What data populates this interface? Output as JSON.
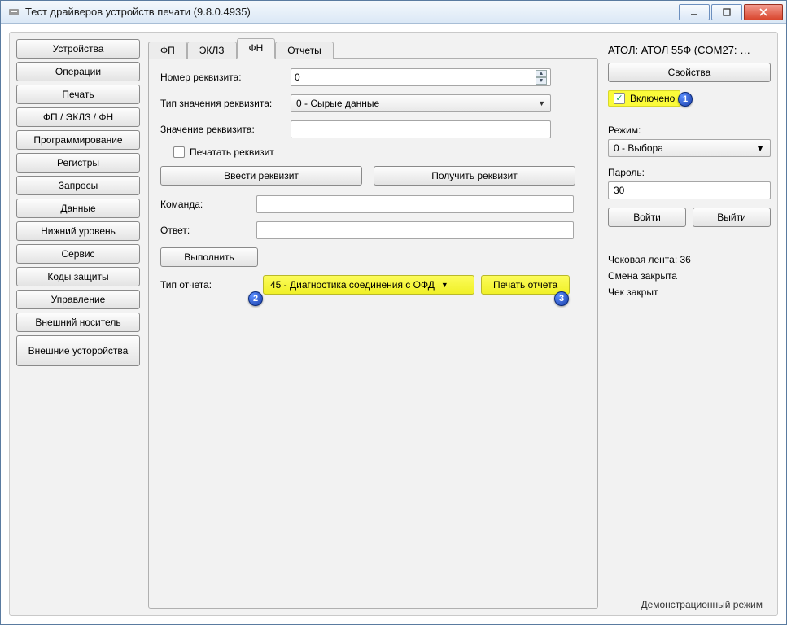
{
  "window": {
    "title": "Тест драйверов устройств печати (9.8.0.4935)"
  },
  "nav": {
    "items": [
      "Устройства",
      "Операции",
      "Печать",
      "ФП / ЭКЛЗ / ФН",
      "Программирование",
      "Регистры",
      "Запросы",
      "Данные",
      "Нижний уровень",
      "Сервис",
      "Коды защиты",
      "Управление",
      "Внешний носитель",
      "Внешние усторойства"
    ]
  },
  "tabs": {
    "items": [
      "ФП",
      "ЭКЛЗ",
      "ФН",
      "Отчеты"
    ],
    "active_index": 2
  },
  "form": {
    "requisite_number_label": "Номер реквизита:",
    "requisite_number_value": "0",
    "requisite_type_label": "Тип значения реквизита:",
    "requisite_type_value": "0 - Сырые данные",
    "requisite_value_label": "Значение реквизита:",
    "requisite_value_value": "",
    "print_req_label": "Печатать реквизит",
    "print_req_checked": false,
    "enter_req_btn": "Ввести реквизит",
    "get_req_btn": "Получить реквизит",
    "command_label": "Команда:",
    "command_value": "",
    "answer_label": "Ответ:",
    "answer_value": "",
    "execute_btn": "Выполнить",
    "report_type_label": "Тип отчета:",
    "report_type_value": "45 - Диагностика соединения с ОФД",
    "print_report_btn": "Печать отчета"
  },
  "right": {
    "device": "АТОЛ: АТОЛ 55Ф (COM27: …",
    "properties_btn": "Свойства",
    "enabled_label": "Включено",
    "enabled_checked": true,
    "mode_label": "Режим:",
    "mode_value": "0 - Выбора",
    "password_label": "Пароль:",
    "password_value": "30",
    "login_btn": "Войти",
    "logout_btn": "Выйти",
    "tape_label": "Чековая лента: 36",
    "session_label": "Смена закрыта",
    "receipt_label": "Чек закрыт"
  },
  "statusbar": "Демонстрационный режим",
  "badges": {
    "b1": "1",
    "b2": "2",
    "b3": "3"
  }
}
